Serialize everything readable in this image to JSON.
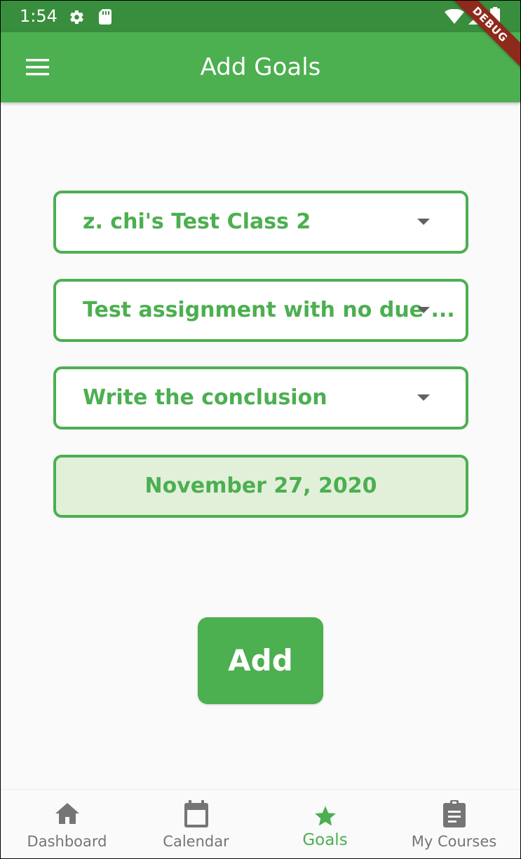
{
  "status_bar": {
    "time": "1:54",
    "icons": [
      "gear-icon",
      "sd-card-icon",
      "wifi-icon",
      "signal-icon",
      "battery-icon"
    ]
  },
  "app_bar": {
    "title": "Add Goals",
    "menu_icon": "hamburger-menu-icon",
    "debug_banner": "DEBUG"
  },
  "form": {
    "class_dropdown": {
      "value": "z. chi's Test Class 2",
      "icon": "dropdown-arrow-icon"
    },
    "assignment_dropdown": {
      "value": "Test assignment with no due ...",
      "icon": "dropdown-arrow-icon"
    },
    "goal_dropdown": {
      "value": "Write the conclusion",
      "icon": "dropdown-arrow-icon"
    },
    "date": {
      "value": "November 27, 2020"
    },
    "add_button": "Add"
  },
  "bottom_nav": {
    "items": [
      {
        "label": "Dashboard",
        "icon": "home-icon",
        "active": false
      },
      {
        "label": "Calendar",
        "icon": "calendar-icon",
        "active": false
      },
      {
        "label": "Goals",
        "icon": "star-icon",
        "active": true
      },
      {
        "label": "My Courses",
        "icon": "clipboard-icon",
        "active": false
      }
    ]
  },
  "colors": {
    "primary": "#4caf50",
    "status_bar": "#388e3c",
    "date_fill": "#e2f0da",
    "inactive_nav": "#757575",
    "debug_banner": "#8d2a1c"
  }
}
